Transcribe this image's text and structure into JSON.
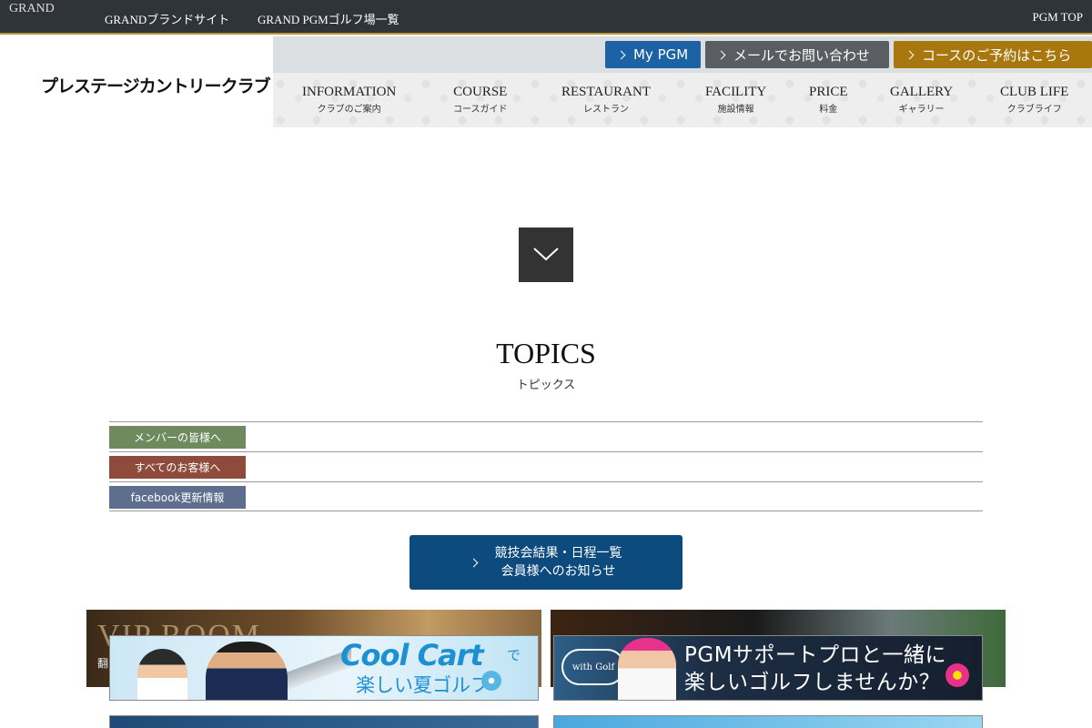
{
  "topbar": {
    "brand_alt": "GRAND",
    "links": [
      "GRANDブランドサイト",
      "GRAND PGMゴルフ場一覧",
      "PGM TOP"
    ]
  },
  "header": {
    "logo": "プレステージカントリークラブ",
    "buttons": [
      {
        "label": "My PGM",
        "color": "#1e62a6"
      },
      {
        "label": "メールでお問い合わせ",
        "color": "#5a5d61"
      },
      {
        "label": "コースのご予約はこちら",
        "color": "#a8780e"
      }
    ],
    "nav": [
      {
        "en": "INFORMATION",
        "jp": "クラブのご案内"
      },
      {
        "en": "COURSE",
        "jp": "コースガイド"
      },
      {
        "en": "RESTAURANT",
        "jp": "レストラン"
      },
      {
        "en": "FACILITY",
        "jp": "施設情報"
      },
      {
        "en": "PRICE",
        "jp": "料金"
      },
      {
        "en": "GALLERY",
        "jp": "ギャラリー"
      },
      {
        "en": "CLUB LIFE",
        "jp": "クラブライフ"
      }
    ]
  },
  "topics": {
    "title": "TOPICS",
    "subtitle": "トピックス",
    "tags": [
      {
        "label": "メンバーの皆様へ",
        "color": "#6e8a5e"
      },
      {
        "label": "すべてのお客様へ",
        "color": "#8e4a3a"
      },
      {
        "label": "facebook更新情報",
        "color": "#5e6e8e"
      }
    ]
  },
  "competition_button": {
    "line1": "競技会結果・日程一覧",
    "line2": "会員様へのお知らせ"
  },
  "banners": {
    "vip_title": "VIP ROOM",
    "vip_sub": "翻",
    "cool_cart_title": "Cool Cart",
    "cool_cart_de": "で",
    "cool_cart_sub": "楽しい夏ゴルフ",
    "with_golf_logo": "with Golf",
    "pgm_support_line1": "PGMサポートプロと一緒に",
    "pgm_support_line2": "楽しいゴルフしませんか？"
  }
}
